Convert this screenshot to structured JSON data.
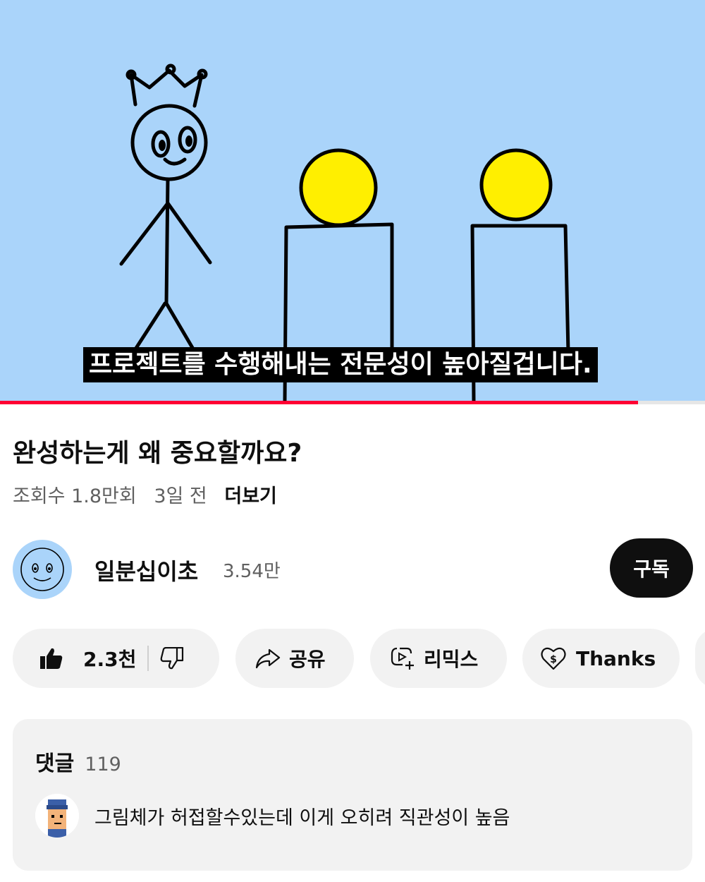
{
  "video": {
    "subtitle": "프로젝트를 수행해내는 전문성이 높아질겁니다.",
    "background_color": "#aad4fa",
    "progress_fraction": 0.905
  },
  "info": {
    "title": "완성하는게 왜 중요할까요?",
    "views": "조회수 1.8만회",
    "age": "3일 전",
    "more": "더보기"
  },
  "channel": {
    "name": "일분십이초",
    "subscribers": "3.54만",
    "subscribe_label": "구독",
    "avatar_icon": "smiley-face-icon"
  },
  "actions": {
    "like_count": "2.3천",
    "share_label": "공유",
    "remix_label": "리믹스",
    "thanks_label": "Thanks",
    "icons": [
      "thumbs-up-icon",
      "thumbs-down-icon",
      "share-arrow-icon",
      "remix-icon",
      "heart-dollar-icon"
    ]
  },
  "comments": {
    "title": "댓글",
    "count": "119",
    "top_comment": {
      "text": "그림체가 허접할수있는데 이게 오히려 직관성이 높음",
      "avatar_icon": "pixel-avatar-icon"
    }
  },
  "colors": {
    "accent_red": "#ff0033",
    "pill_bg": "#f2f2f2",
    "subscribe_bg": "#0f0f0f",
    "secondary_text": "#606060"
  }
}
